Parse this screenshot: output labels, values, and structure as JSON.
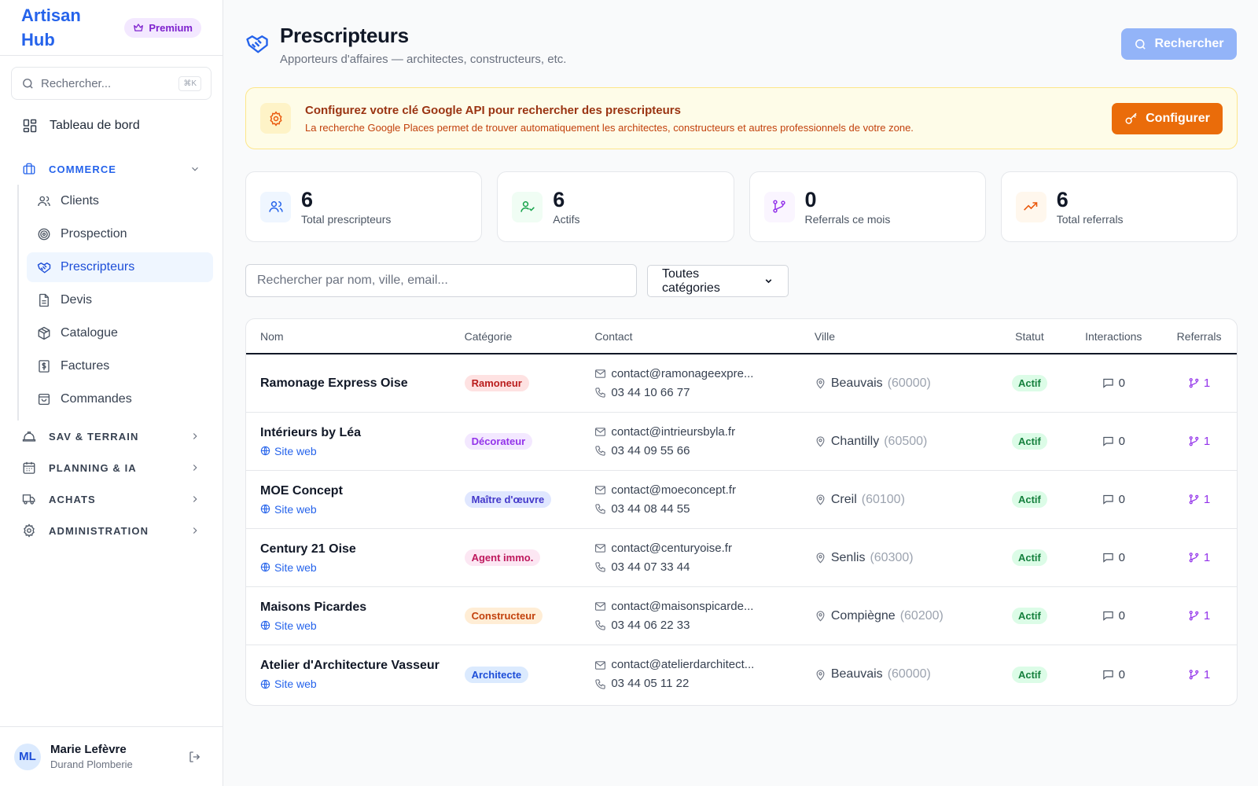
{
  "sidebar": {
    "brand": "Artisan Hub",
    "premium_label": "Premium",
    "search_placeholder": "Rechercher...",
    "search_shortcut": "⌘K",
    "dashboard_label": "Tableau de bord",
    "sections": {
      "commerce": "COMMERCE",
      "sav": "SAV & TERRAIN",
      "planning": "PLANNING & IA",
      "achats": "ACHATS",
      "admin": "ADMINISTRATION"
    },
    "commerce_items": [
      "Clients",
      "Prospection",
      "Prescripteurs",
      "Devis",
      "Catalogue",
      "Factures",
      "Commandes"
    ],
    "user": {
      "initials": "ML",
      "name": "Marie Lefèvre",
      "company": "Durand Plomberie"
    }
  },
  "header": {
    "title": "Prescripteurs",
    "subtitle": "Apporteurs d'affaires — architectes, constructeurs, etc.",
    "search_button": "Rechercher"
  },
  "banner": {
    "title": "Configurez votre clé Google API pour rechercher des prescripteurs",
    "text": "La recherche Google Places permet de trouver automatiquement les architectes, constructeurs et autres professionnels de votre zone.",
    "button": "Configurer"
  },
  "stats": [
    {
      "value": "6",
      "label": "Total prescripteurs",
      "icon": "users-icon",
      "color": "#2563eb",
      "bg": "#eff6ff"
    },
    {
      "value": "6",
      "label": "Actifs",
      "icon": "user-check-icon",
      "color": "#16a34a",
      "bg": "#f0fdf4"
    },
    {
      "value": "0",
      "label": "Referrals ce mois",
      "icon": "git-branch-icon",
      "color": "#9333ea",
      "bg": "#faf5ff"
    },
    {
      "value": "6",
      "label": "Total referrals",
      "icon": "trending-up-icon",
      "color": "#ea580c",
      "bg": "#fff7ed"
    }
  ],
  "filters": {
    "search_placeholder": "Rechercher par nom, ville, email...",
    "category_selected": "Toutes catégories"
  },
  "table": {
    "headers": {
      "name": "Nom",
      "category": "Catégorie",
      "contact": "Contact",
      "city": "Ville",
      "status": "Statut",
      "interactions": "Interactions",
      "referrals": "Referrals"
    },
    "website_label": "Site web",
    "rows": [
      {
        "name": "Ramonage Express Oise",
        "website": false,
        "category": "Ramoneur",
        "cat_fg": "#b91c1c",
        "cat_bg": "#fee2e2",
        "email": "contact@ramonageexpre...",
        "phone": "03 44 10 66 77",
        "city": "Beauvais",
        "zip": "(60000)",
        "status": "Actif",
        "interactions": "0",
        "referrals": "1"
      },
      {
        "name": "Intérieurs by Léa",
        "website": true,
        "category": "Décorateur",
        "cat_fg": "#9333ea",
        "cat_bg": "#f3e8ff",
        "email": "contact@intrieursbyla.fr",
        "phone": "03 44 09 55 66",
        "city": "Chantilly",
        "zip": "(60500)",
        "status": "Actif",
        "interactions": "0",
        "referrals": "1"
      },
      {
        "name": "MOE Concept",
        "website": true,
        "category": "Maître d'œuvre",
        "cat_fg": "#4338ca",
        "cat_bg": "#e0e7ff",
        "email": "contact@moeconcept.fr",
        "phone": "03 44 08 44 55",
        "city": "Creil",
        "zip": "(60100)",
        "status": "Actif",
        "interactions": "0",
        "referrals": "1"
      },
      {
        "name": "Century 21 Oise",
        "website": true,
        "category": "Agent immo.",
        "cat_fg": "#be185d",
        "cat_bg": "#fce7f3",
        "email": "contact@centuryoise.fr",
        "phone": "03 44 07 33 44",
        "city": "Senlis",
        "zip": "(60300)",
        "status": "Actif",
        "interactions": "0",
        "referrals": "1"
      },
      {
        "name": "Maisons Picardes",
        "website": true,
        "category": "Constructeur",
        "cat_fg": "#c2410c",
        "cat_bg": "#ffedd5",
        "email": "contact@maisonspicarde...",
        "phone": "03 44 06 22 33",
        "city": "Compiègne",
        "zip": "(60200)",
        "status": "Actif",
        "interactions": "0",
        "referrals": "1"
      },
      {
        "name": "Atelier d'Architecture Vasseur",
        "website": true,
        "category": "Architecte",
        "cat_fg": "#1d4ed8",
        "cat_bg": "#dbeafe",
        "email": "contact@atelierdarchitect...",
        "phone": "03 44 05 11 22",
        "city": "Beauvais",
        "zip": "(60000)",
        "status": "Actif",
        "interactions": "0",
        "referrals": "1"
      }
    ]
  }
}
